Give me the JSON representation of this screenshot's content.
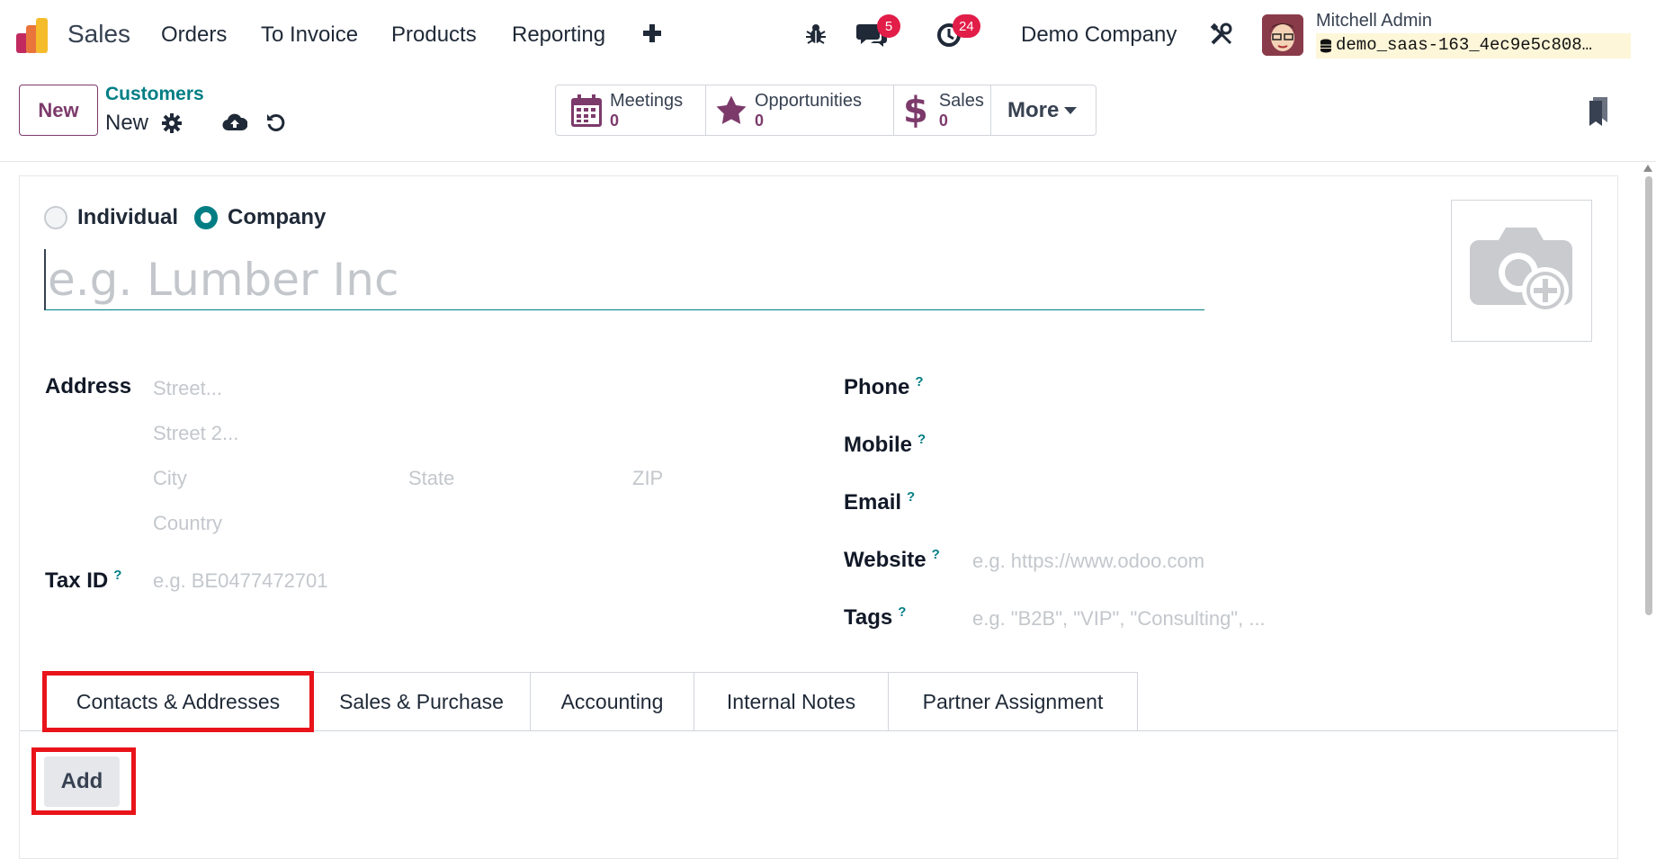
{
  "navbar": {
    "app_name": "Sales",
    "menus": [
      "Orders",
      "To Invoice",
      "Products",
      "Reporting"
    ],
    "chat_count": "5",
    "activity_count": "24",
    "company": "Demo Company",
    "user_name": "Mitchell Admin",
    "database": "demo_saas-163_4ec9e5c808…"
  },
  "control": {
    "new_label": "New",
    "breadcrumb": "Customers",
    "record_name": "New",
    "stats": [
      {
        "label": "Meetings",
        "value": "0"
      },
      {
        "label": "Opportunities",
        "value": "0"
      },
      {
        "label": "Sales",
        "value": "0"
      }
    ],
    "more_label": "More"
  },
  "form": {
    "type_individual": "Individual",
    "type_company": "Company",
    "name_placeholder": "e.g. Lumber Inc",
    "address_label": "Address",
    "street_ph": "Street...",
    "street2_ph": "Street 2...",
    "city_ph": "City",
    "state_ph": "State",
    "zip_ph": "ZIP",
    "country_ph": "Country",
    "taxid_label": "Tax ID",
    "taxid_ph": "e.g. BE0477472701",
    "phone_label": "Phone",
    "mobile_label": "Mobile",
    "email_label": "Email",
    "website_label": "Website",
    "website_ph": "e.g. https://www.odoo.com",
    "tags_label": "Tags",
    "tags_ph": "e.g. \"B2B\", \"VIP\", \"Consulting\", ...",
    "help_mark": "?"
  },
  "tabs": [
    "Contacts & Addresses",
    "Sales & Purchase",
    "Accounting",
    "Internal Notes",
    "Partner Assignment"
  ],
  "add_label": "Add",
  "colors": {
    "primary": "#7c3a6b",
    "accent": "#017e84",
    "highlight": "#e8141a",
    "badge": "#e11d48"
  }
}
